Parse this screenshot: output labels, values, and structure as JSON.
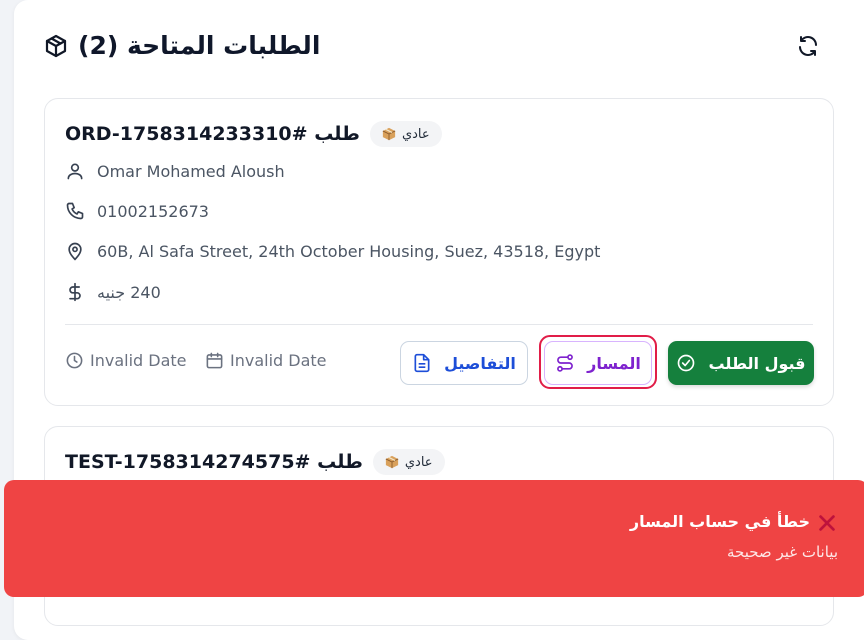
{
  "header": {
    "title": "الطلبات المتاحة (2)",
    "icons": {
      "box": "package-icon",
      "refresh": "refresh-icon"
    }
  },
  "orders": [
    {
      "title": "طلب #ORD-1758314233310",
      "priority_badge": "عادي",
      "customer_name": "Omar Mohamed Aloush",
      "phone": "01002152673",
      "address": "60B, Al Safa Street, 24th October Housing, Suez, 43518, Egypt",
      "amount": "240 جنيه",
      "time": "Invalid Date",
      "date": "Invalid Date",
      "buttons": {
        "details": "التفاصيل",
        "route": "المسار",
        "accept": "قبول الطلب"
      }
    },
    {
      "title": "طلب #TEST-1758314274575",
      "priority_badge": "عادي"
    }
  ],
  "toast": {
    "title": "خطأ في حساب المسار",
    "message": "بيانات غير صحيحة"
  },
  "colors": {
    "accept": "#15803d",
    "route_text": "#7e22ce",
    "details_text": "#1d4ed8",
    "toast_bg": "#ef4444",
    "focus_ring": "#e11d48"
  }
}
